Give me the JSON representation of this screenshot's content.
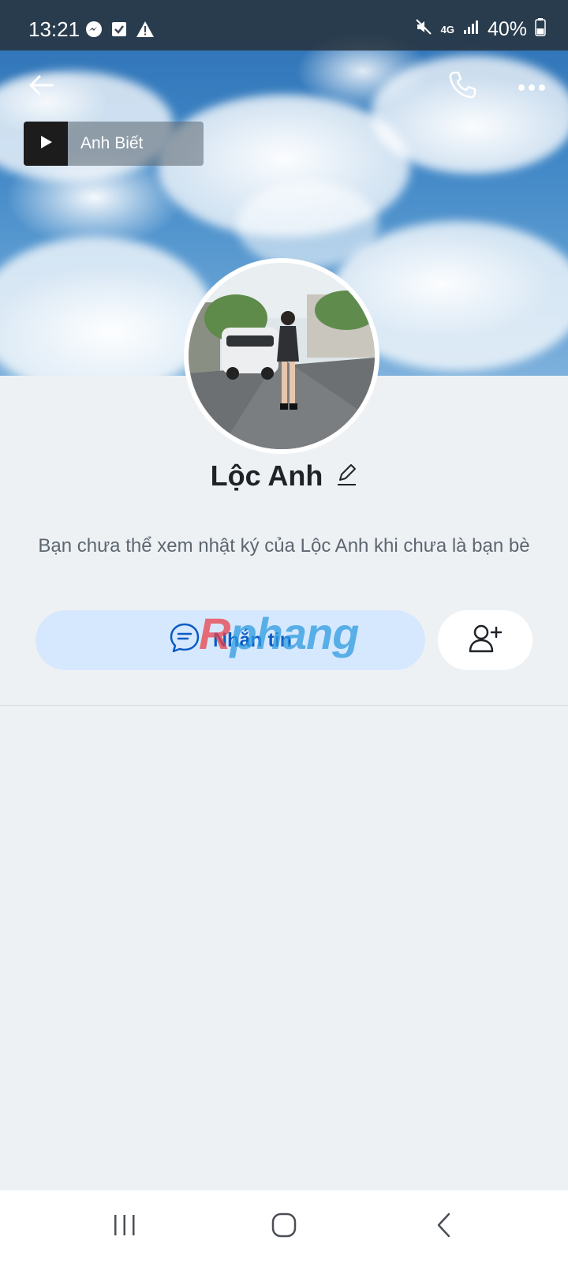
{
  "status_bar": {
    "time": "13:21",
    "left_icons": [
      "messenger-icon",
      "check-icon",
      "warning-icon"
    ],
    "network": "4G",
    "battery": "40%",
    "battery_level": 0.4
  },
  "top_actions": {
    "icons": [
      "back-arrow-icon",
      "phone-icon",
      "more-icon"
    ]
  },
  "music": {
    "title": "Anh Biết",
    "icon": "play-icon"
  },
  "profile": {
    "name": "Lộc Anh",
    "notice": "Bạn chưa thể xem nhật ký của Lộc Anh khi chưa là bạn bè"
  },
  "actions": {
    "message_label": "Nhắn tin",
    "add_friend_icon": "add-friend-icon"
  },
  "watermark": {
    "first": "R",
    "rest": "phang"
  },
  "colors": {
    "accent": "#0a5bc4",
    "message_bg": "#d6e8fd",
    "page_bg": "#eef1f4"
  }
}
